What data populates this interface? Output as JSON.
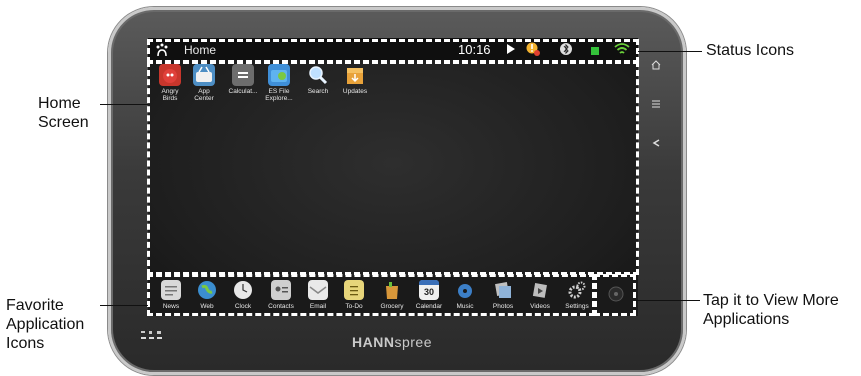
{
  "callouts": {
    "home_screen": [
      "Home",
      "Screen"
    ],
    "status_icons": "Status Icons",
    "favorite": [
      "Favorite",
      "Application",
      "Icons"
    ],
    "tap_more": [
      "Tap it to View More",
      "Applications"
    ]
  },
  "statusbar": {
    "title": "Home",
    "time": "10:16"
  },
  "apps": [
    {
      "label": [
        "Angry",
        "Birds"
      ],
      "icon": "angry-birds-icon",
      "color": "#c8362c"
    },
    {
      "label": [
        "App",
        "Center"
      ],
      "icon": "app-center-icon",
      "color": "#4d8ec4"
    },
    {
      "label": [
        "Calculat..."
      ],
      "icon": "calculator-icon",
      "color": "#6d6d6d"
    },
    {
      "label": [
        "ES File",
        "Explore..."
      ],
      "icon": "es-file-explorer-icon",
      "color": "#3f8fd8"
    },
    {
      "label": [
        "Search"
      ],
      "icon": "search-icon",
      "color": "#7aaee0"
    },
    {
      "label": [
        "Updates"
      ],
      "icon": "updates-icon",
      "color": "#e8a23a"
    }
  ],
  "favorites": [
    {
      "label": "News",
      "icon": "news-icon",
      "color": "#d9d9d9"
    },
    {
      "label": "Web",
      "icon": "globe-icon",
      "color": "#3b8ed0"
    },
    {
      "label": "Clock",
      "icon": "clock-icon",
      "color": "#e0e0e0"
    },
    {
      "label": "Contacts",
      "icon": "contacts-icon",
      "color": "#cfcfcf"
    },
    {
      "label": "Email",
      "icon": "email-icon",
      "color": "#e9e9e9"
    },
    {
      "label": "To-Do",
      "icon": "todo-icon",
      "color": "#e7d57a"
    },
    {
      "label": "Grocery",
      "icon": "grocery-icon",
      "color": "#d8973a"
    },
    {
      "label": "Calendar",
      "icon": "calendar-icon",
      "color": "#3a6fb8"
    },
    {
      "label": "Music",
      "icon": "music-icon",
      "color": "#3c7fc7"
    },
    {
      "label": "Photos",
      "icon": "photos-icon",
      "color": "#8a8a8a"
    },
    {
      "label": "Videos",
      "icon": "videos-icon",
      "color": "#bdbdbd"
    },
    {
      "label": "Settings",
      "icon": "settings-icon",
      "color": "#bcbcbc"
    }
  ],
  "calendar_day": "30",
  "brand": {
    "bold": "HANN",
    "light": "spree"
  }
}
